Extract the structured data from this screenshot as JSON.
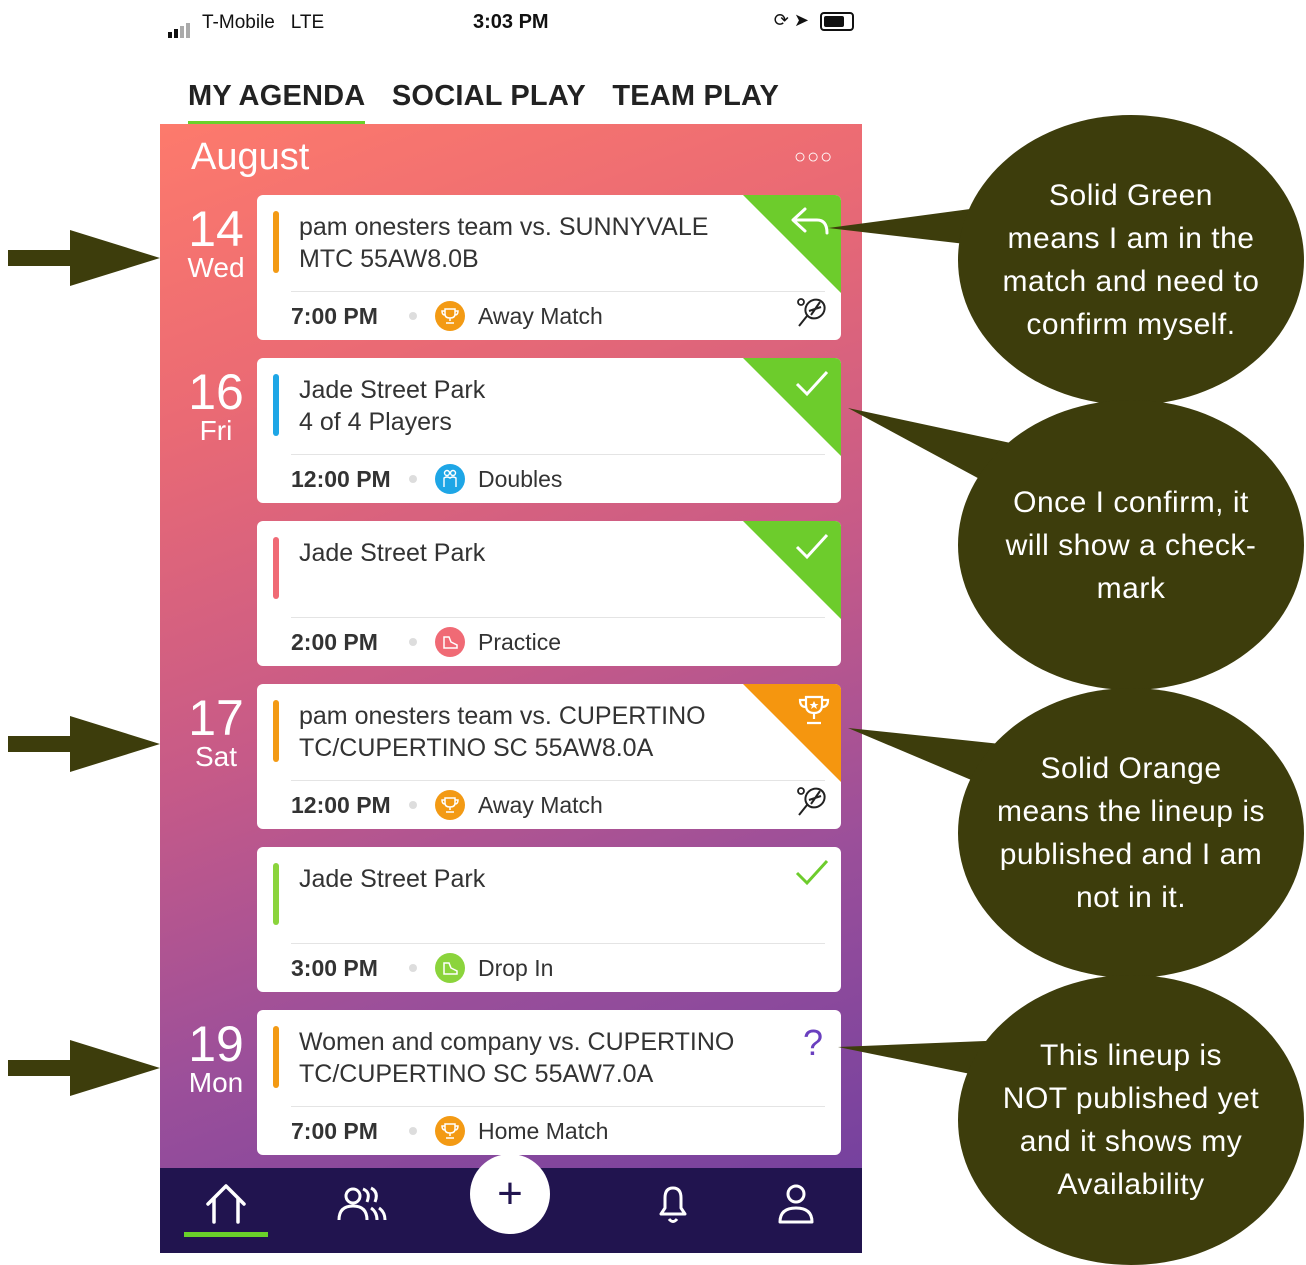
{
  "status_bar": {
    "carrier": "T-Mobile",
    "network": "LTE",
    "time": "3:03 PM"
  },
  "tabs": [
    {
      "label": "MY AGENDA",
      "active": true
    },
    {
      "label": "SOCIAL PLAY",
      "active": false
    },
    {
      "label": "TEAM PLAY",
      "active": false
    }
  ],
  "agenda": {
    "month": "August",
    "more_icon": "more-dots-icon",
    "days": [
      {
        "num": "14",
        "dow": "Wed"
      },
      {
        "num": "16",
        "dow": "Fri"
      },
      {
        "num": "17",
        "dow": "Sat"
      },
      {
        "num": "19",
        "dow": "Mon"
      }
    ],
    "events": [
      {
        "title_line1": "pam onesters team vs. SUNNYVALE",
        "title_line2": "MTC 55AW8.0B",
        "time": "7:00 PM",
        "type": "Away Match",
        "type_icon": "trophy-icon",
        "status_icon": "reply-icon",
        "corner_color": "#6dcc2c",
        "bar_color": "#f39a14"
      },
      {
        "title_line1": "Jade Street Park",
        "title_line2": "4 of 4 Players",
        "time": "12:00 PM",
        "type": "Doubles",
        "type_icon": "doubles-players-icon",
        "status_icon": "checkmark-icon",
        "corner_color": "#6dcc2c",
        "bar_color": "#1ea6e6"
      },
      {
        "title_line1": "Jade Street Park",
        "title_line2": "",
        "time": "2:00 PM",
        "type": "Practice",
        "type_icon": "shoe-icon",
        "status_icon": "checkmark-icon",
        "corner_color": "#6dcc2c",
        "bar_color": "#f06a75"
      },
      {
        "title_line1": "pam onesters team vs. CUPERTINO",
        "title_line2": "TC/CUPERTINO SC 55AW8.0A",
        "time": "12:00 PM",
        "type": "Away Match",
        "type_icon": "trophy-icon",
        "status_icon": "trophy-icon",
        "corner_color": "#f5960f",
        "bar_color": "#f39a14"
      },
      {
        "title_line1": "Jade Street Park",
        "title_line2": "",
        "time": "3:00 PM",
        "type": "Drop In",
        "type_icon": "shoe-icon",
        "status_icon": "checkmark-icon",
        "corner_color": "",
        "bar_color": "#8bd43c"
      },
      {
        "title_line1": "Women and company vs. CUPERTINO",
        "title_line2": "TC/CUPERTINO SC 55AW7.0A",
        "time": "7:00 PM",
        "type": "Home Match",
        "type_icon": "trophy-icon",
        "status_icon": "question-icon",
        "status_text": "?",
        "corner_color": "",
        "bar_color": "#f39a14"
      }
    ]
  },
  "bottom_nav": [
    {
      "icon": "home-icon"
    },
    {
      "icon": "groups-icon"
    },
    {
      "icon": "add-icon",
      "label": "+"
    },
    {
      "icon": "bell-icon"
    },
    {
      "icon": "profile-icon"
    }
  ],
  "annotations": [
    "Solid Green means I am in the match and need to confirm myself.",
    "Once I confirm, it will show a check-mark",
    "Solid Orange means the lineup is published and I am not in it.",
    "This lineup is NOT published yet and it shows my Availability"
  ],
  "annotation_lines": [
    [
      "Solid Green",
      "means I am in the",
      "match and need to",
      "confirm myself."
    ],
    [
      "Once I confirm, it",
      "will show a check-",
      "mark"
    ],
    [
      "Solid Orange",
      "means the lineup is",
      "published and I am",
      "not in it."
    ],
    [
      "This lineup is",
      "NOT published yet",
      "and it shows my",
      "Availability"
    ]
  ],
  "colors": {
    "accent_green": "#6ad12a",
    "nav_bg": "#21144f",
    "annotation_bg": "#3d3d0c",
    "arrow_color": "#3d3d0c",
    "question_purple": "#6a3fbf"
  }
}
